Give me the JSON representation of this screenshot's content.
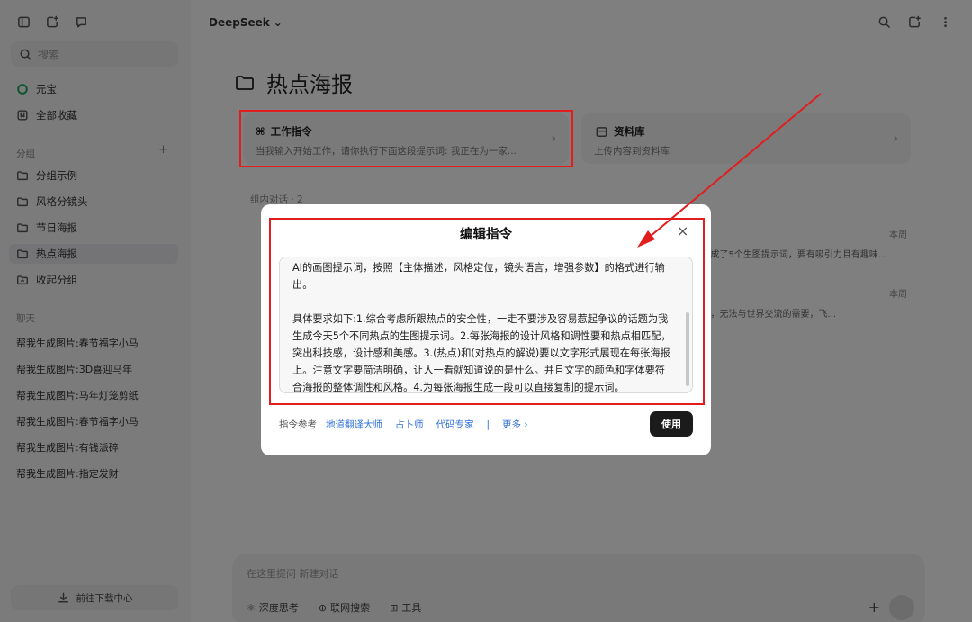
{
  "sidebar": {
    "search_placeholder": "搜索",
    "nav": [
      {
        "label": "元宝",
        "icon": "yuanbao-logo-icon"
      },
      {
        "label": "全部收藏",
        "icon": "bookmark-icon"
      }
    ],
    "groups_title": "分组",
    "groups_add": "+",
    "groups": [
      {
        "label": "分组示例",
        "icon": "folder-icon"
      },
      {
        "label": "风格分镜头",
        "icon": "folder-icon"
      },
      {
        "label": "节日海报",
        "icon": "folder-icon"
      },
      {
        "label": "热点海报",
        "icon": "folder-icon",
        "active": true
      },
      {
        "label": "收起分组",
        "icon": "folder-collapse-icon"
      }
    ],
    "chats_title": "聊天",
    "chats": [
      "帮我生成图片:春节福字小马",
      "帮我生成图片:3D喜迎马年",
      "帮我生成图片:马年灯笼剪纸",
      "帮我生成图片:春节福字小马",
      "帮我生成图片:有钱派碎",
      "帮我生成图片:指定发财"
    ],
    "download_label": "前往下载中心"
  },
  "header": {
    "brand": "DeepSeek",
    "brand_chevron": "⌄"
  },
  "page": {
    "title": "热点海报"
  },
  "cards": {
    "work": {
      "title": "工作指令",
      "desc": "当我输入开始工作，请你执行下面这段提示词: 我正在为一家...",
      "chevron": "›"
    },
    "library": {
      "title": "资料库",
      "desc": "上传内容到资料库",
      "chevron": "›"
    }
  },
  "group_chats": {
    "label": "组内对话 · 2",
    "dates": [
      "本周",
      "本周"
    ],
    "snippets": [
      "...生成了5个生图提示词，要有吸引力且有趣味...",
      "...合，无法与世界交流的需要，飞..."
    ]
  },
  "input": {
    "placeholder": "在这里提问   新建对话",
    "tools": [
      "深度思考",
      "联网搜索",
      "工具"
    ],
    "plus": "+"
  },
  "modal": {
    "title": "编辑指令",
    "close": "×",
    "text_para1": "AI的画图提示词，按照【主体描述，风格定位，镜头语言，增强参数】的格式进行输出。",
    "text_para2": "具体要求如下:1.综合考虑所跟热点的安全性，一走不要涉及容易惹起争议的话题为我生成今天5个不同热点的生图提示词。2.每张海报的设计风格和调性要和热点相匹配，突出科技感，设计感和美感。3.(热点)和(对热点的解说)要以文字形式展现在每张海报上。注意文字要简洁明确，让人一看就知道说的是什么。并且文字的颜色和字体要符合海报的整体调性和风格。4.为每张海报生成一段可以直接复制的提示词。",
    "ref_label": "指令参考",
    "ref_links": [
      "地道翻译大师",
      "占卜师",
      "代码专家"
    ],
    "ref_sep": "|",
    "more": "更多 ›",
    "use_button": "使用"
  },
  "colors": {
    "annotation_red": "#e21d1d",
    "link_blue": "#2f6fd6",
    "primary_button": "#1b1b1b"
  }
}
